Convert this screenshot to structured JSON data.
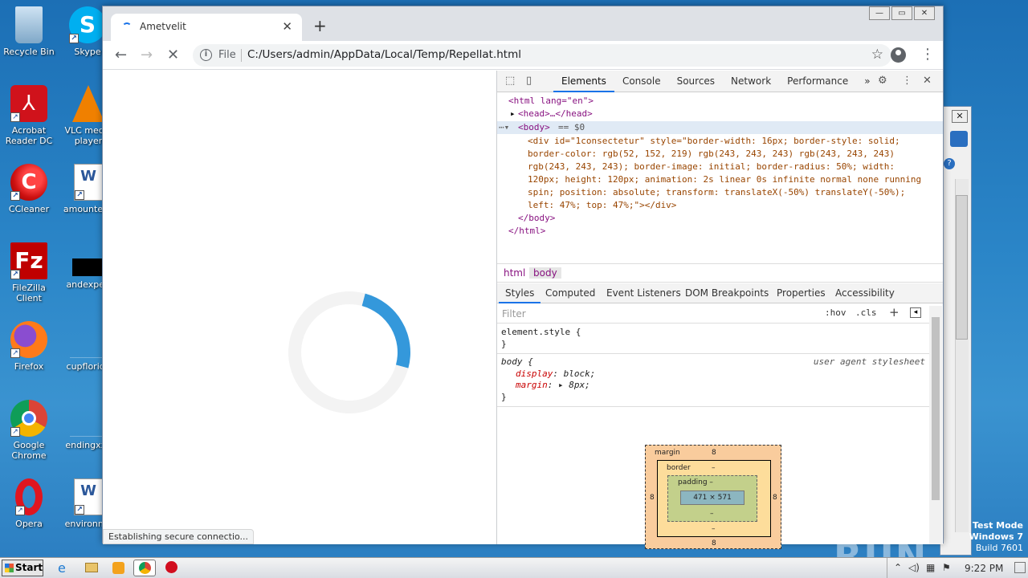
{
  "desktop": {
    "icons": [
      {
        "label": "Recycle Bin"
      },
      {
        "label": "Skype"
      },
      {
        "label": "Acrobat Reader DC"
      },
      {
        "label": "VLC media player"
      },
      {
        "label": "CCleaner"
      },
      {
        "label": "amountenc"
      },
      {
        "label": "FileZilla Client"
      },
      {
        "label": "andexperi"
      },
      {
        "label": "Firefox"
      },
      {
        "label": "cupflorida"
      },
      {
        "label": "Google Chrome"
      },
      {
        "label": "endingxxx"
      },
      {
        "label": "Opera"
      },
      {
        "label": "environme"
      }
    ],
    "watermark": "ANY RUN",
    "test_mode": {
      "line1": "Test Mode",
      "line2": "Windows 7",
      "line3": "Build 7601"
    }
  },
  "browser": {
    "tab_title": "Ametvelit",
    "tab_close": "✕",
    "new_tab": "+",
    "url_scheme": "File",
    "url": "C:/Users/admin/AppData/Local/Temp/Repellat.html",
    "status_text": "Establishing secure connectio...",
    "window_buttons": {
      "minimize": "—",
      "maximize": "▭",
      "close": "✕"
    },
    "spinner_colors": {
      "track": "#f3f3f3",
      "accent": "#3498db"
    }
  },
  "devtools": {
    "tabs": [
      "Elements",
      "Console",
      "Sources",
      "Network",
      "Performance"
    ],
    "more_tabs": "»",
    "dom": {
      "line1": "<html lang=\"en\">",
      "line2": "<head>…</head>",
      "body_open": "<body>",
      "body_eq": "== $0",
      "div_text": "<div id=\"1consectetur\" style=\"border-width: 16px; border-style: solid; border-color: rgb(52, 152, 219) rgb(243, 243, 243) rgb(243, 243, 243) rgb(243, 243, 243); border-image: initial; border-radius: 50%; width: 120px; height: 120px; animation: 2s linear 0s infinite normal none running spin; position: absolute; transform: translateX(-50%) translateY(-50%); left: 47%; top: 47%;\"></div>",
      "body_close": "</body>",
      "html_close": "</html>"
    },
    "breadcrumbs": [
      "html",
      "body"
    ],
    "sub_tabs": [
      "Styles",
      "Computed",
      "Event Listeners",
      "DOM Breakpoints",
      "Properties",
      "Accessibility"
    ],
    "filter_placeholder": "Filter",
    "hov": ":hov",
    "cls": ".cls",
    "styles": {
      "element_style_open": "element.style {",
      "close_brace": "}",
      "body_selector": "body {",
      "ua_label": "user agent stylesheet",
      "prop1_name": "display",
      "prop1_value": "block;",
      "prop2_name": "margin",
      "prop2_value": "8px;"
    },
    "box_model": {
      "margin_label": "margin",
      "margin_top": "8",
      "margin_bottom": "8",
      "margin_left": "8",
      "margin_right": "8",
      "border_label": "border",
      "border_dash": "–",
      "padding_label": "padding –",
      "content": "471 × 571",
      "dash": "–"
    }
  },
  "taskbar": {
    "start_label": "Start",
    "clock": "9:22 PM"
  }
}
